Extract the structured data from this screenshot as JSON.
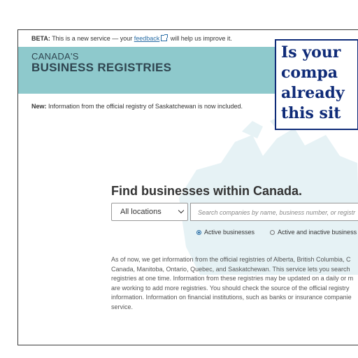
{
  "beta": {
    "label": "BETA:",
    "text_before": "This is a new service — your",
    "link": "feedback",
    "text_after": "will help us improve it."
  },
  "header": {
    "brand_top": "CANADA'S",
    "brand_main": "BUSINESS REGISTRIES",
    "background_color": "#8ec9cc"
  },
  "notice": {
    "label": "New:",
    "text": "Information from the official registry of Saskatchewan is now included."
  },
  "callout": {
    "lines": [
      "Is your",
      "compa",
      "already",
      "this sit"
    ],
    "color": "#0f2b78"
  },
  "search": {
    "heading": "Find businesses within Canada.",
    "location_value": "All locations",
    "placeholder": "Search companies by name, business number, or registr"
  },
  "filters": {
    "active_label": "Active businesses",
    "all_label": "Active and inactive business",
    "selected": "active"
  },
  "info": {
    "lines": [
      "As of now, we get information from the official registries of Alberta, British Columbia, C",
      "Canada, Manitoba, Ontario, Quebec, and Saskatchewan. This service lets you search",
      "registries at one time. Information from these registries may be updated on a daily or m",
      "are working to add more registries. You should check the source of the official registry",
      "information. Information on financial institutions, such as banks or insurance companie",
      "service."
    ]
  }
}
